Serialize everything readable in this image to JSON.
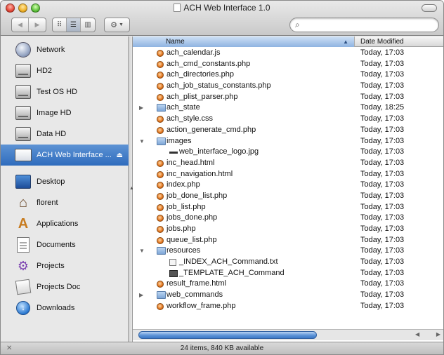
{
  "window": {
    "title": "ACH Web Interface 1.0"
  },
  "toolbar": {
    "back_icon": "back-arrow-icon",
    "forward_icon": "forward-arrow-icon",
    "view_modes": [
      "icon-view-icon",
      "list-view-icon",
      "column-view-icon"
    ],
    "selected_view": "list-view-icon",
    "action_icon": "gear-icon",
    "search": {
      "value": "",
      "placeholder": ""
    }
  },
  "sidebar": {
    "devices": [
      {
        "label": "Network",
        "icon": "network-globe-icon"
      },
      {
        "label": "HD2",
        "icon": "hard-drive-icon"
      },
      {
        "label": "Test OS HD",
        "icon": "hard-drive-icon"
      },
      {
        "label": "Image HD",
        "icon": "hard-drive-icon"
      },
      {
        "label": "Data HD",
        "icon": "hard-drive-icon"
      },
      {
        "label": "ACH Web Interface ...",
        "icon": "disk-image-icon",
        "selected": true,
        "eject": "eject-icon"
      }
    ],
    "places": [
      {
        "label": "Desktop",
        "icon": "desktop-icon"
      },
      {
        "label": "florent",
        "icon": "home-icon"
      },
      {
        "label": "Applications",
        "icon": "applications-icon"
      },
      {
        "label": "Documents",
        "icon": "documents-icon"
      },
      {
        "label": "Projects",
        "icon": "projects-icon"
      },
      {
        "label": "Projects Doc",
        "icon": "projects-doc-icon"
      },
      {
        "label": "Downloads",
        "icon": "downloads-icon"
      }
    ]
  },
  "list": {
    "columns": {
      "name": "Name",
      "date": "Date Modified"
    },
    "rows": [
      {
        "name": "ach_calendar.js",
        "date": "Today, 17:03",
        "kind": "file",
        "indent": 0
      },
      {
        "name": "ach_cmd_constants.php",
        "date": "Today, 17:03",
        "kind": "file",
        "indent": 0
      },
      {
        "name": "ach_directories.php",
        "date": "Today, 17:03",
        "kind": "file",
        "indent": 0
      },
      {
        "name": "ach_job_status_constants.php",
        "date": "Today, 17:03",
        "kind": "file",
        "indent": 0
      },
      {
        "name": "ach_plist_parser.php",
        "date": "Today, 17:03",
        "kind": "file",
        "indent": 0
      },
      {
        "name": "ach_state",
        "date": "Today, 18:25",
        "kind": "folder",
        "indent": 0,
        "disclosure": "collapsed"
      },
      {
        "name": "ach_style.css",
        "date": "Today, 17:03",
        "kind": "file",
        "indent": 0
      },
      {
        "name": "action_generate_cmd.php",
        "date": "Today, 17:03",
        "kind": "file",
        "indent": 0
      },
      {
        "name": "images",
        "date": "Today, 17:03",
        "kind": "folder",
        "indent": 0,
        "disclosure": "expanded"
      },
      {
        "name": "web_interface_logo.jpg",
        "date": "Today, 17:03",
        "kind": "image",
        "indent": 1
      },
      {
        "name": "inc_head.html",
        "date": "Today, 17:03",
        "kind": "file",
        "indent": 0
      },
      {
        "name": "inc_navigation.html",
        "date": "Today, 17:03",
        "kind": "file",
        "indent": 0
      },
      {
        "name": "index.php",
        "date": "Today, 17:03",
        "kind": "file",
        "indent": 0
      },
      {
        "name": "job_done_list.php",
        "date": "Today, 17:03",
        "kind": "file",
        "indent": 0
      },
      {
        "name": "job_list.php",
        "date": "Today, 17:03",
        "kind": "file",
        "indent": 0
      },
      {
        "name": "jobs_done.php",
        "date": "Today, 17:03",
        "kind": "file",
        "indent": 0
      },
      {
        "name": "jobs.php",
        "date": "Today, 17:03",
        "kind": "file",
        "indent": 0
      },
      {
        "name": "queue_list.php",
        "date": "Today, 17:03",
        "kind": "file",
        "indent": 0
      },
      {
        "name": "resources",
        "date": "Today, 17:03",
        "kind": "folder",
        "indent": 0,
        "disclosure": "expanded"
      },
      {
        "name": "_INDEX_ACH_Command.txt",
        "date": "Today, 17:03",
        "kind": "text",
        "indent": 1
      },
      {
        "name": "_TEMPLATE_ACH_Command",
        "date": "Today, 17:03",
        "kind": "doc",
        "indent": 1
      },
      {
        "name": "result_frame.html",
        "date": "Today, 17:03",
        "kind": "file",
        "indent": 0
      },
      {
        "name": "web_commands",
        "date": "Today, 17:03",
        "kind": "folder",
        "indent": 0,
        "disclosure": "collapsed"
      },
      {
        "name": "workflow_frame.php",
        "date": "Today, 17:03",
        "kind": "file",
        "indent": 0
      }
    ]
  },
  "status": {
    "text": "24 items, 840 KB available"
  }
}
